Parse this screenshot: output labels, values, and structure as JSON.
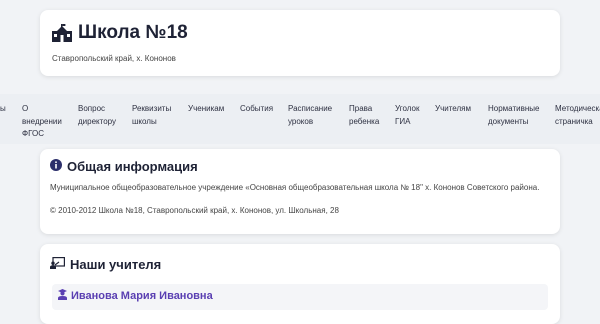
{
  "header": {
    "title": "Школа №18",
    "subtitle": "Ставропольский край, х. Кононов"
  },
  "nav": {
    "items": [
      "ы",
      "О\nвнедрении\nФГОС",
      "Вопрос\nдиректору",
      "Реквизиты\nшколы",
      "Ученикам",
      "События",
      "Расписание\nуроков",
      "Права\nребенка",
      "Уголок\nГИА",
      "Учителям",
      "Нормативные\nдокументы",
      "Методическая\nстраничка"
    ]
  },
  "info": {
    "title": "Общая информация",
    "description": "Муниципальное общеобразовательное учреждение «Основная общеобразовательная школа № 18\" х. Кононов Советского района.",
    "copyright": "© 2010-2012 Школа №18, Ставропольский край, х. Кононов, ул. Школьная, 28"
  },
  "teachers": {
    "title": "Наши учителя",
    "items": [
      {
        "name": "Иванова Мария Ивановна"
      }
    ]
  },
  "icons": {
    "school": "school-icon",
    "info": "info-circle-icon",
    "teacher_board": "chalkboard-teacher-icon",
    "user": "user-graduate-icon"
  },
  "colors": {
    "page_bg": "#f1f3f6",
    "accent": "#2c2f6b",
    "teacher_name": "#5a3fb2"
  }
}
